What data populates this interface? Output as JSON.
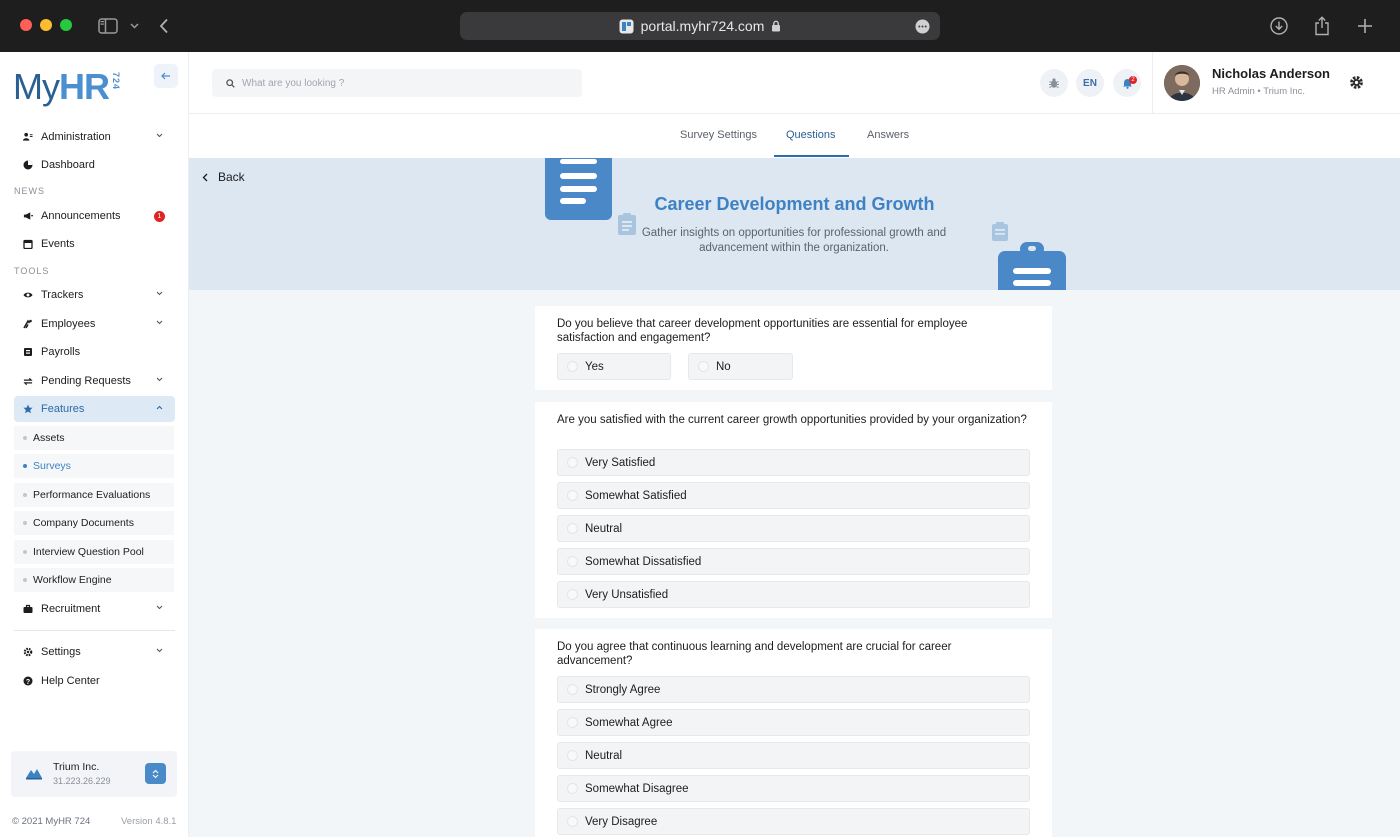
{
  "browser": {
    "url": "portal.myhr724.com"
  },
  "logo": {
    "my": "My",
    "hr": "HR",
    "num": "724"
  },
  "sidebar": {
    "admin": "Administration",
    "dashboard": "Dashboard",
    "news_label": "NEWS",
    "announcements": "Announcements",
    "announcements_badge": "1",
    "events": "Events",
    "tools_label": "TOOLS",
    "trackers": "Trackers",
    "employees": "Employees",
    "payrolls": "Payrolls",
    "pending": "Pending Requests",
    "features": "Features",
    "sub": [
      "Assets",
      "Surveys",
      "Performance Evaluations",
      "Company Documents",
      "Interview Question Pool",
      "Workflow Engine"
    ],
    "recruitment": "Recruitment",
    "settings": "Settings",
    "help": "Help Center",
    "company_name": "Trium Inc.",
    "company_ip": "31.223.26.229",
    "copyright": "© 2021 MyHR 724",
    "version": "Version 4.8.1"
  },
  "topbar": {
    "search_placeholder": "What are you looking ?",
    "lang": "EN",
    "notif_count": "2",
    "user_name": "Nicholas Anderson",
    "user_role": "HR Admin • Trium Inc."
  },
  "tabs": [
    "Survey Settings",
    "Questions",
    "Answers"
  ],
  "banner": {
    "back": "Back",
    "title": "Career Development and Growth",
    "desc": "Gather insights on opportunities for professional growth and advancement within the organization."
  },
  "questions": [
    {
      "text": "Do you believe that career development opportunities are essential for employee satisfaction and engagement?",
      "options": [
        "Yes",
        "No"
      ]
    },
    {
      "text": "Are you satisfied with the current career growth opportunities provided by your organization?",
      "options": [
        "Very Satisfied",
        "Somewhat Satisfied",
        "Neutral",
        "Somewhat Dissatisfied",
        "Very Unsatisfied"
      ]
    },
    {
      "text": "Do you agree that continuous learning and development are crucial for career advancement?",
      "options": [
        "Strongly Agree",
        "Somewhat Agree",
        "Neutral",
        "Somewhat Disagree",
        "Very Disagree"
      ]
    }
  ],
  "colors": {
    "accent": "#3e82c4",
    "banner_bg": "#dce7f2",
    "active_nav_bg": "#dde9f4"
  },
  "icons": [
    "sidebar-toggle-icon",
    "back-arrow-icon",
    "lock-icon",
    "download-icon",
    "share-icon",
    "plus-icon",
    "search-icon",
    "bug-icon",
    "bell-icon",
    "gear-icon"
  ]
}
